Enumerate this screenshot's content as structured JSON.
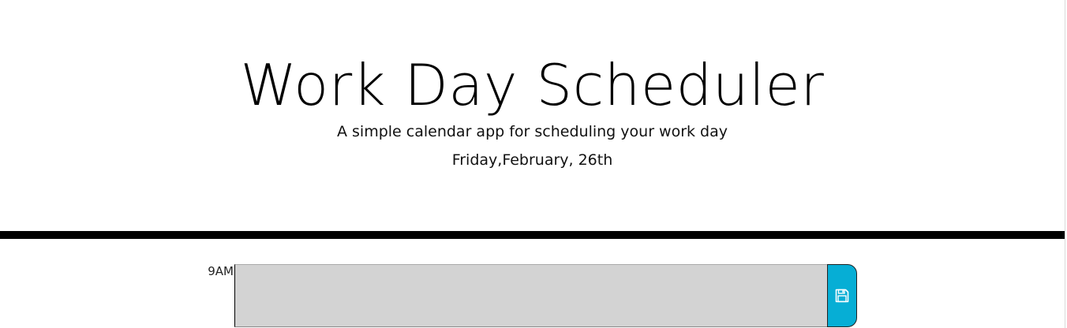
{
  "header": {
    "title": "Work Day Scheduler",
    "subtitle": "A simple calendar app for scheduling your work day",
    "current_day": "Friday,February, 26th"
  },
  "schedule": {
    "blocks": [
      {
        "hour": "9AM",
        "text": "",
        "status": "past",
        "save_icon": "floppy-disk-icon"
      }
    ]
  },
  "colors": {
    "past_block": "#d3d3d3",
    "save_button": "#06aed5",
    "divider": "#000000"
  }
}
